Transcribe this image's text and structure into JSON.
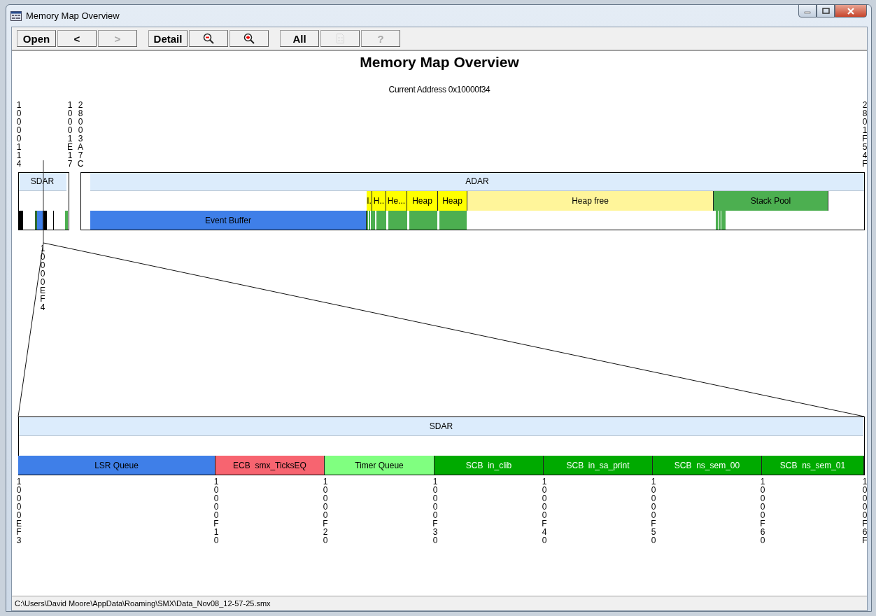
{
  "window": {
    "title": "Memory Map Overview"
  },
  "toolbar": [
    {
      "kind": "text",
      "label": "Open",
      "disabled": false
    },
    {
      "kind": "text",
      "label": "<",
      "disabled": false
    },
    {
      "kind": "text",
      "label": ">",
      "disabled": true
    },
    {
      "kind": "text",
      "label": "Detail",
      "disabled": false
    },
    {
      "kind": "zoom-out",
      "disabled": false
    },
    {
      "kind": "zoom-in",
      "disabled": false
    },
    {
      "kind": "text",
      "label": "All",
      "disabled": false
    },
    {
      "kind": "document",
      "disabled": true
    },
    {
      "kind": "text",
      "label": "?",
      "disabled": true
    }
  ],
  "map": {
    "title": "Memory Map Overview",
    "current_address": "Current Address 0x10000f34",
    "top_addresses": [
      "10000114",
      "10001E17",
      "28003A7C",
      "2801F54F"
    ],
    "sdar": {
      "label": "SDAR"
    },
    "adar": {
      "label": "ADAR",
      "blocks": [
        {
          "label": "I.",
          "color": "#ffff00"
        },
        {
          "label": "H..",
          "color": "#ffff00"
        },
        {
          "label": "He...",
          "color": "#ffff00"
        },
        {
          "label": "Heap",
          "color": "#ffff00"
        },
        {
          "label": "Heap",
          "color": "#ffff00"
        },
        {
          "label": "Heap free",
          "color": "#fff59a"
        },
        {
          "label": "Stack Pool",
          "color": "#4caf50"
        }
      ],
      "event_buffer": {
        "label": "Event Buffer",
        "color": "#3f7fe8"
      }
    },
    "cursor_address": "10000EF4",
    "detail": {
      "label": "SDAR",
      "blocks": [
        {
          "label": "LSR Queue",
          "color": "#3f7fe8"
        },
        {
          "label": "ECB  smx_TicksEQ",
          "color": "#f76470"
        },
        {
          "label": "Timer Queue",
          "color": "#80ff80"
        },
        {
          "label": "SCB  in_clib",
          "color": "#00aa00"
        },
        {
          "label": "SCB  in_sa_print",
          "color": "#00aa00"
        },
        {
          "label": "SCB  ns_sem_00",
          "color": "#00aa00"
        },
        {
          "label": "SCB  ns_sem_01",
          "color": "#00aa00"
        }
      ],
      "addresses": [
        "10000EF3",
        "10000F10",
        "10000F20",
        "10000F30",
        "10000F40",
        "10000F50",
        "10000F60",
        "10000F6F"
      ]
    }
  },
  "status_bar": {
    "path": "C:\\Users\\David Moore\\AppData\\Roaming\\SMX\\Data_Nov08_12-57-25.smx"
  }
}
